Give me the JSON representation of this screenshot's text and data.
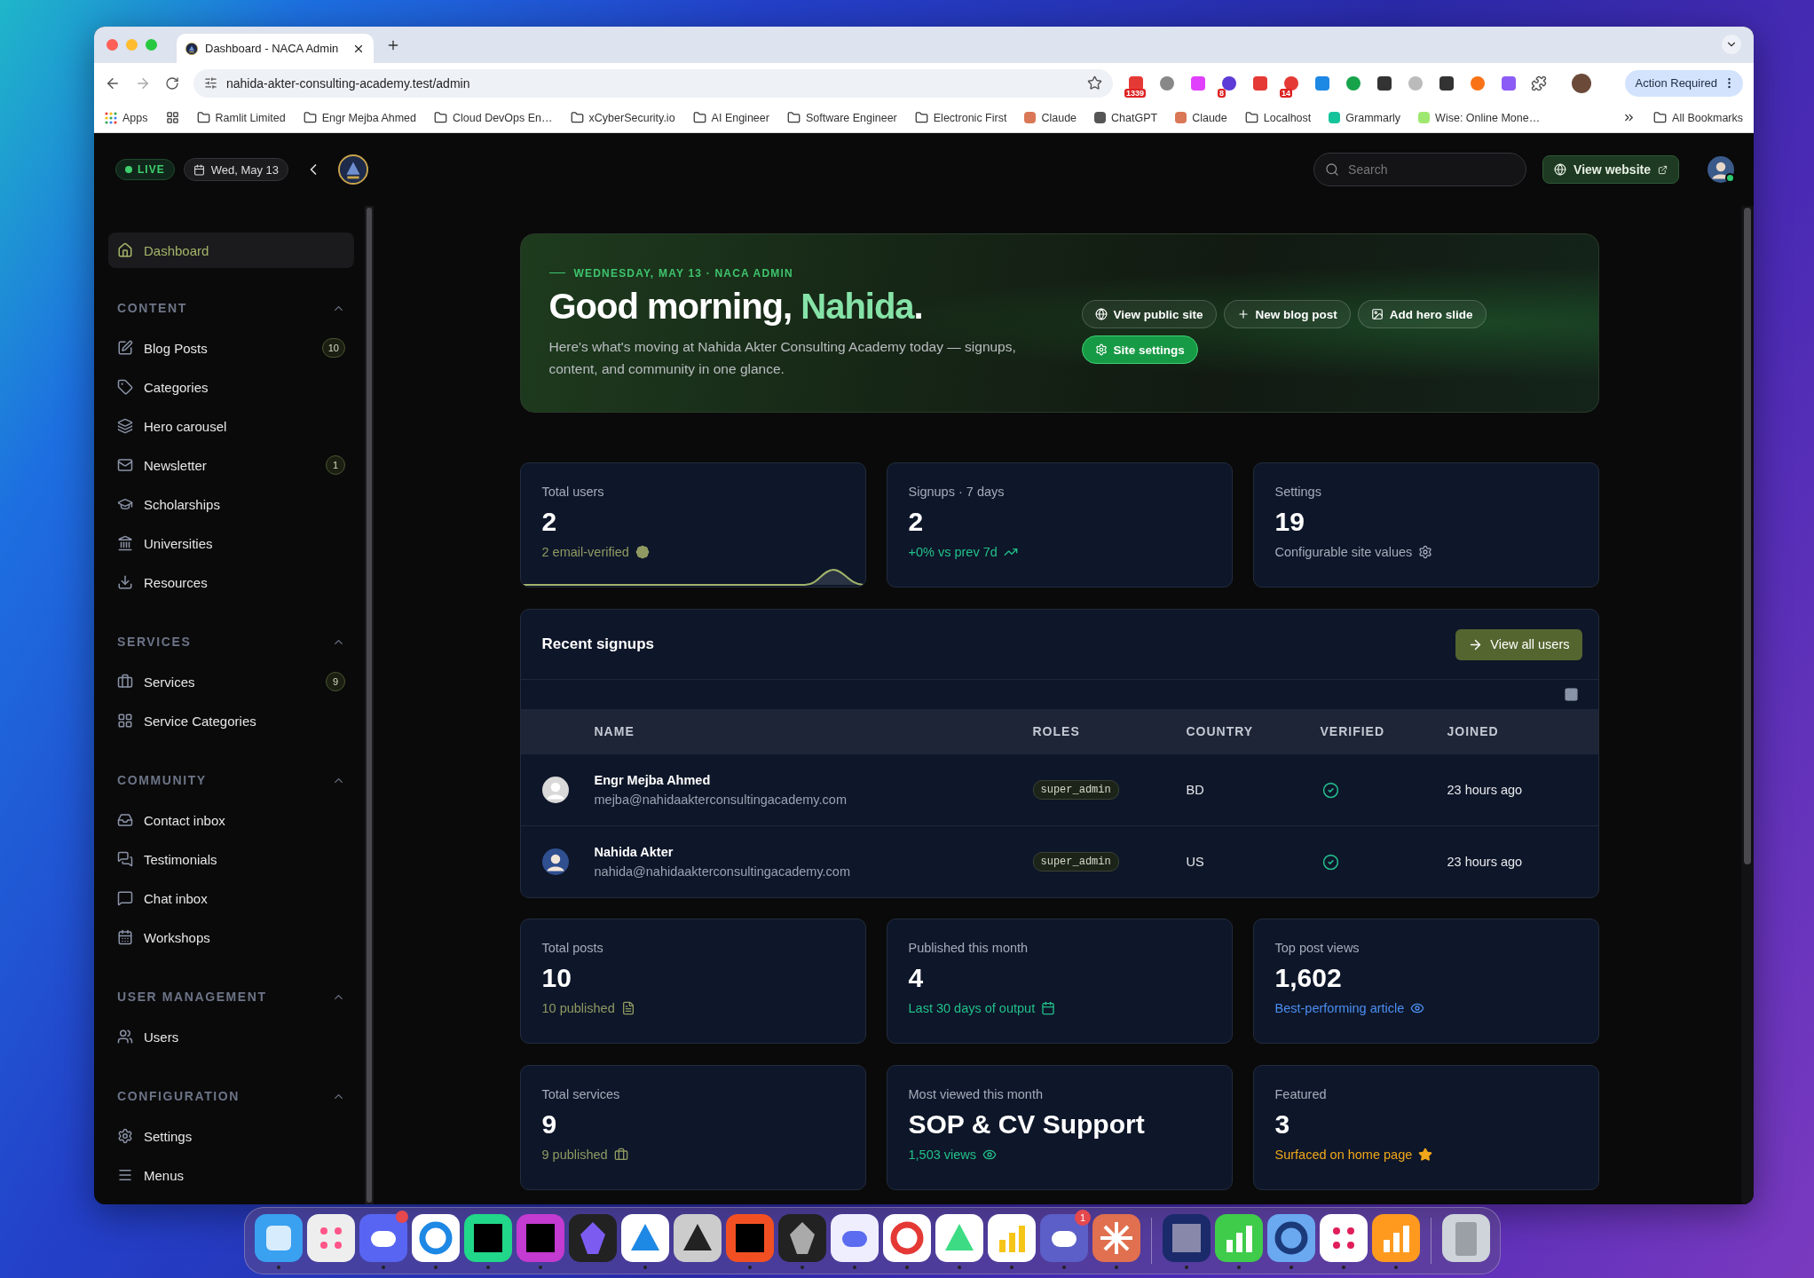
{
  "browser": {
    "tabs": [
      {
        "title": "Dashboard - NACA Admin",
        "selected": true
      }
    ],
    "url": "nahida-akter-consulting-academy.test/admin",
    "extension_badges": [
      "1339",
      "8",
      "14"
    ],
    "action_button": "Action Required",
    "bookmarks": [
      {
        "label": "Apps",
        "kind": "apps"
      },
      {
        "label": "Ramlit Limited",
        "kind": "folder"
      },
      {
        "label": "Engr Mejba Ahmed",
        "kind": "folder"
      },
      {
        "label": "Cloud DevOps En…",
        "kind": "folder"
      },
      {
        "label": "xCyberSecurity.io",
        "kind": "folder"
      },
      {
        "label": "AI Engineer",
        "kind": "folder"
      },
      {
        "label": "Software Engineer",
        "kind": "folder"
      },
      {
        "label": "Electronic First",
        "kind": "folder"
      },
      {
        "label": "Claude",
        "kind": "site",
        "color": "#d97757"
      },
      {
        "label": "ChatGPT",
        "kind": "site",
        "color": "#555555"
      },
      {
        "label": "Claude",
        "kind": "site",
        "color": "#d97757"
      },
      {
        "label": "Localhost",
        "kind": "folder"
      },
      {
        "label": "Grammarly",
        "kind": "site",
        "color": "#15c39a"
      },
      {
        "label": "Wise: Online Mone…",
        "kind": "site",
        "color": "#9fe870"
      }
    ],
    "all_bookmarks": "All Bookmarks"
  },
  "header": {
    "live": "LIVE",
    "date": "Wed, May 13",
    "search": {
      "placeholder": "Search"
    },
    "view_website": "View website"
  },
  "sidebar": {
    "items": [
      {
        "label": "Dashboard",
        "selected": true
      }
    ],
    "sections": [
      {
        "title": "CONTENT",
        "expanded": true,
        "items": [
          {
            "label": "Blog Posts",
            "count": "10",
            "selected": false
          },
          {
            "label": "Categories",
            "selected": false
          },
          {
            "label": "Hero carousel",
            "selected": false
          },
          {
            "label": "Newsletter",
            "count": "1",
            "selected": false
          },
          {
            "label": "Scholarships",
            "selected": false
          },
          {
            "label": "Universities",
            "selected": false
          },
          {
            "label": "Resources",
            "selected": false
          }
        ]
      },
      {
        "title": "SERVICES",
        "expanded": true,
        "items": [
          {
            "label": "Services",
            "count": "9",
            "selected": false
          },
          {
            "label": "Service Categories",
            "selected": false
          }
        ]
      },
      {
        "title": "COMMUNITY",
        "expanded": true,
        "items": [
          {
            "label": "Contact inbox",
            "selected": false
          },
          {
            "label": "Testimonials",
            "selected": false
          },
          {
            "label": "Chat inbox",
            "selected": false
          },
          {
            "label": "Workshops",
            "selected": false
          }
        ]
      },
      {
        "title": "USER MANAGEMENT",
        "expanded": true,
        "items": [
          {
            "label": "Users",
            "selected": false
          }
        ]
      },
      {
        "title": "CONFIGURATION",
        "expanded": true,
        "items": [
          {
            "label": "Settings",
            "selected": false
          },
          {
            "label": "Menus",
            "selected": false
          }
        ]
      }
    ]
  },
  "hero": {
    "eyebrow": "WEDNESDAY, MAY 13 · NACA ADMIN",
    "greeting": "Good morning,",
    "name": "Nahida",
    "punctuation": ".",
    "description": "Here's what's moving at Nahida Akter Consulting Academy today — signups, content, and community in one glance.",
    "buttons": [
      {
        "label": "View public site",
        "kind": "outline"
      },
      {
        "label": "New blog post",
        "kind": "outline"
      },
      {
        "label": "Add hero slide",
        "kind": "outline"
      },
      {
        "label": "Site settings",
        "kind": "primary"
      }
    ]
  },
  "stats_top": [
    {
      "label": "Total users",
      "value": "2",
      "note": "2 email-verified",
      "color": "#8f9a62",
      "kind": "sparkline"
    },
    {
      "label": "Signups · 7 days",
      "value": "2",
      "note": "+0% vs prev 7d",
      "color": "#22c08a",
      "kind": "plain"
    },
    {
      "label": "Settings",
      "value": "19",
      "note": "Configurable site values",
      "color": "#a4acba",
      "kind": "plain"
    }
  ],
  "recent_signups": {
    "title": "Recent signups",
    "button": "View all users",
    "columns": [
      "NAME",
      "ROLES",
      "COUNTRY",
      "VERIFIED",
      "JOINED"
    ],
    "rows": [
      {
        "name": "Engr Mejba Ahmed",
        "email": "mejba@nahidaakterconsultingacademy.com",
        "role": "super_admin",
        "country": "BD",
        "verified": true,
        "joined": "23 hours ago",
        "kind": "placeholder"
      },
      {
        "name": "Nahida Akter",
        "email": "nahida@nahidaakterconsultingacademy.com",
        "role": "super_admin",
        "country": "US",
        "verified": true,
        "joined": "23 hours ago",
        "kind": "photo"
      }
    ]
  },
  "stats_bottom": [
    {
      "label": "Total posts",
      "value": "10",
      "note": "10 published",
      "color": "#8f9a62"
    },
    {
      "label": "Published this month",
      "value": "4",
      "note": "Last 30 days of output",
      "color": "#22c08a"
    },
    {
      "label": "Top post views",
      "value": "1,602",
      "note": "Best-performing article",
      "color": "#4a8ff0"
    },
    {
      "label": "Total services",
      "value": "9",
      "note": "9 published",
      "color": "#8f9a62"
    },
    {
      "label": "Most viewed this month",
      "value": "SOP & CV Support",
      "note": "1,503 views",
      "color": "#22c08a"
    },
    {
      "label": "Featured",
      "value": "3",
      "note": "Surfaced on home page",
      "color": "#f0a81a"
    }
  ],
  "dock": {
    "items": [
      {
        "running": true,
        "alert": false
      },
      {
        "running": false,
        "alert": false
      },
      {
        "running": true,
        "alert": true
      },
      {
        "running": true,
        "alert": false
      },
      {
        "running": true,
        "alert": false
      },
      {
        "running": true,
        "alert": false
      },
      {
        "running": false,
        "alert": false
      },
      {
        "running": true,
        "alert": false
      },
      {
        "running": false,
        "alert": false
      },
      {
        "running": true,
        "alert": false
      },
      {
        "running": true,
        "alert": false
      },
      {
        "running": true,
        "alert": false
      },
      {
        "running": true,
        "alert": false
      },
      {
        "running": true,
        "alert": false
      },
      {
        "running": true,
        "alert": false
      },
      {
        "running": true,
        "alert": false,
        "badge": "1"
      },
      {
        "running": true,
        "alert": false
      },
      {
        "running": true,
        "alert": false
      },
      {
        "running": true,
        "alert": false
      },
      {
        "running": true,
        "alert": false
      },
      {
        "running": true,
        "alert": false
      },
      {
        "running": true,
        "alert": false
      },
      {
        "running": false,
        "alert": false
      }
    ]
  }
}
